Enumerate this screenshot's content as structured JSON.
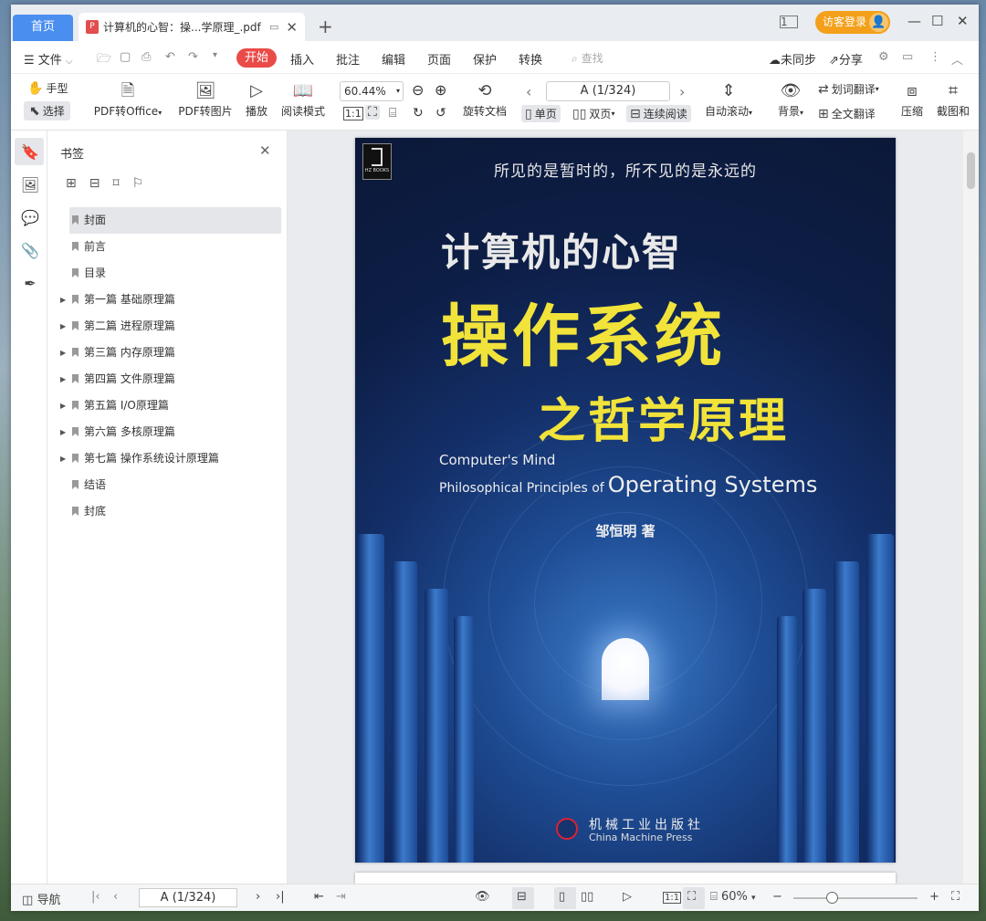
{
  "tabs": {
    "home": "首页",
    "doc_title": "计算机的心智：操...学原理_.pdf"
  },
  "login": "访客登录",
  "menu": {
    "file": "文件",
    "start": "开始",
    "insert": "插入",
    "comment": "批注",
    "edit": "编辑",
    "page": "页面",
    "protect": "保护",
    "convert": "转换",
    "search_placeholder": "查找",
    "unsync": "未同步",
    "share": "分享"
  },
  "toolbar": {
    "hand": "手型",
    "select": "选择",
    "to_office": "PDF转Office",
    "to_image": "PDF转图片",
    "play": "播放",
    "read_mode": "阅读模式",
    "zoom": "60.44%",
    "rotate": "旋转文档",
    "page_indicator": "A (1/324)",
    "single": "单页",
    "double": "双页",
    "continuous": "连续阅读",
    "auto_scroll": "自动滚动",
    "background": "背景",
    "word_translate": "划词翻译",
    "full_translate": "全文翻译",
    "compress": "压缩",
    "screenshot": "截图和"
  },
  "bookmarks": {
    "title": "书签",
    "items": [
      {
        "label": "封面",
        "expandable": false
      },
      {
        "label": "前言",
        "expandable": false
      },
      {
        "label": "目录",
        "expandable": false
      },
      {
        "label": "第一篇 基础原理篇",
        "expandable": true
      },
      {
        "label": "第二篇 进程原理篇",
        "expandable": true
      },
      {
        "label": "第三篇 内存原理篇",
        "expandable": true
      },
      {
        "label": "第四篇 文件原理篇",
        "expandable": true
      },
      {
        "label": "第五篇 I/O原理篇",
        "expandable": true
      },
      {
        "label": "第六篇 多核原理篇",
        "expandable": true
      },
      {
        "label": "第七篇 操作系统设计原理篇",
        "expandable": true
      },
      {
        "label": "结语",
        "expandable": false
      },
      {
        "label": "封底",
        "expandable": false
      }
    ]
  },
  "cover": {
    "motto": "所见的是暂时的，所不见的是永远的",
    "title_line1": "计算机的心智",
    "title_line2": "操作系统",
    "title_line3": "之哲学原理",
    "english_line1": "Computer's Mind",
    "english_line2a": "Philosophical Principles of",
    "english_line2b": "Operating Systems",
    "author": "邹恒明 著",
    "publisher_cn": "机械工业出版社",
    "publisher_en": "China Machine Press",
    "logo_text": "HZ BOOKS"
  },
  "status": {
    "nav": "导航",
    "page_indicator": "A (1/324)",
    "zoom": "60%"
  },
  "colors": {
    "accent": "#4a8ff0",
    "start": "#e94b48",
    "login": "#f4a01a",
    "cover_title": "#f1e33a"
  }
}
